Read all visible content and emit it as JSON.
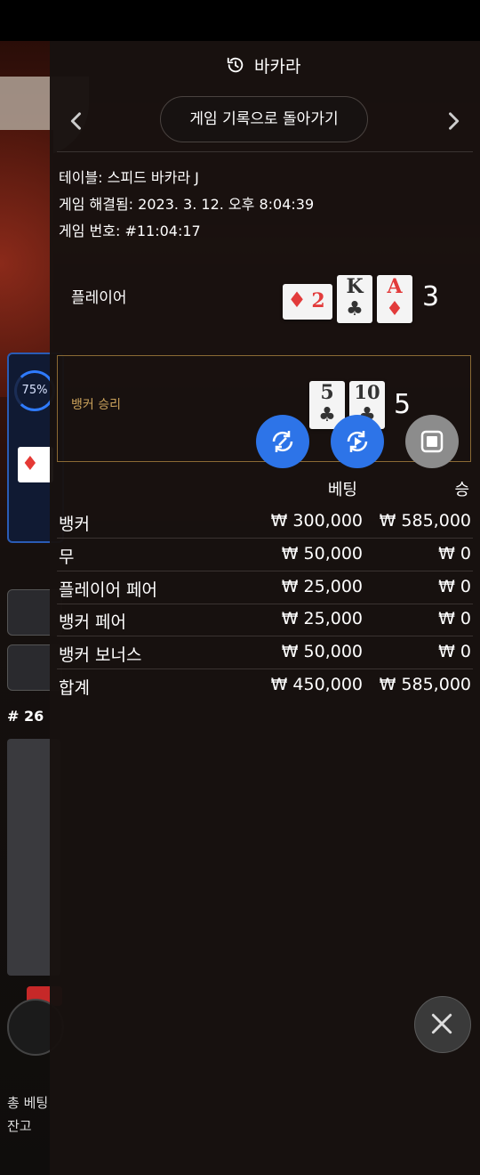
{
  "header": {
    "title": "바카라",
    "back_label": "게임 기록으로 돌아가기"
  },
  "info": {
    "table": "테이블: 스피드 바카라 J",
    "resolved": "게임 해결됨: 2023. 3. 12. 오후 8:04:39",
    "game_no": "게임 번호: #11:04:17"
  },
  "player": {
    "label": "플레이어",
    "score": "3",
    "cards": [
      {
        "rank": "2",
        "suit": "♦",
        "color": "red"
      },
      {
        "rank": "K",
        "suit": "♣",
        "color": "black"
      },
      {
        "rank": "A",
        "suit": "♦",
        "color": "red"
      }
    ]
  },
  "banker": {
    "label": "뱅커 승리",
    "score": "5",
    "cards": [
      {
        "rank": "5",
        "suit": "♣",
        "color": "black"
      },
      {
        "rank": "10",
        "suit": "♣",
        "color": "black"
      }
    ]
  },
  "columns": {
    "bet": "베팅",
    "win": "승"
  },
  "rows": [
    {
      "name": "뱅커",
      "bet": "₩ 300,000",
      "win": "₩ 585,000"
    },
    {
      "name": "무",
      "bet": "₩ 50,000",
      "win": "₩ 0"
    },
    {
      "name": "플레이어 페어",
      "bet": "₩ 25,000",
      "win": "₩ 0"
    },
    {
      "name": "뱅커 페어",
      "bet": "₩ 25,000",
      "win": "₩ 0"
    },
    {
      "name": "뱅커 보너스",
      "bet": "₩ 50,000",
      "win": "₩ 0"
    },
    {
      "name": "합계",
      "bet": "₩ 450,000",
      "win": "₩ 585,000"
    }
  ],
  "background": {
    "progress_pct": "75%",
    "round_label": "# 26",
    "total_bet_label": "총 베팅",
    "balance_label": "잔고"
  },
  "colors": {
    "accent_blue": "#2d74e8",
    "win_gold": "#c9a15b",
    "panel_bg": "#181210"
  }
}
